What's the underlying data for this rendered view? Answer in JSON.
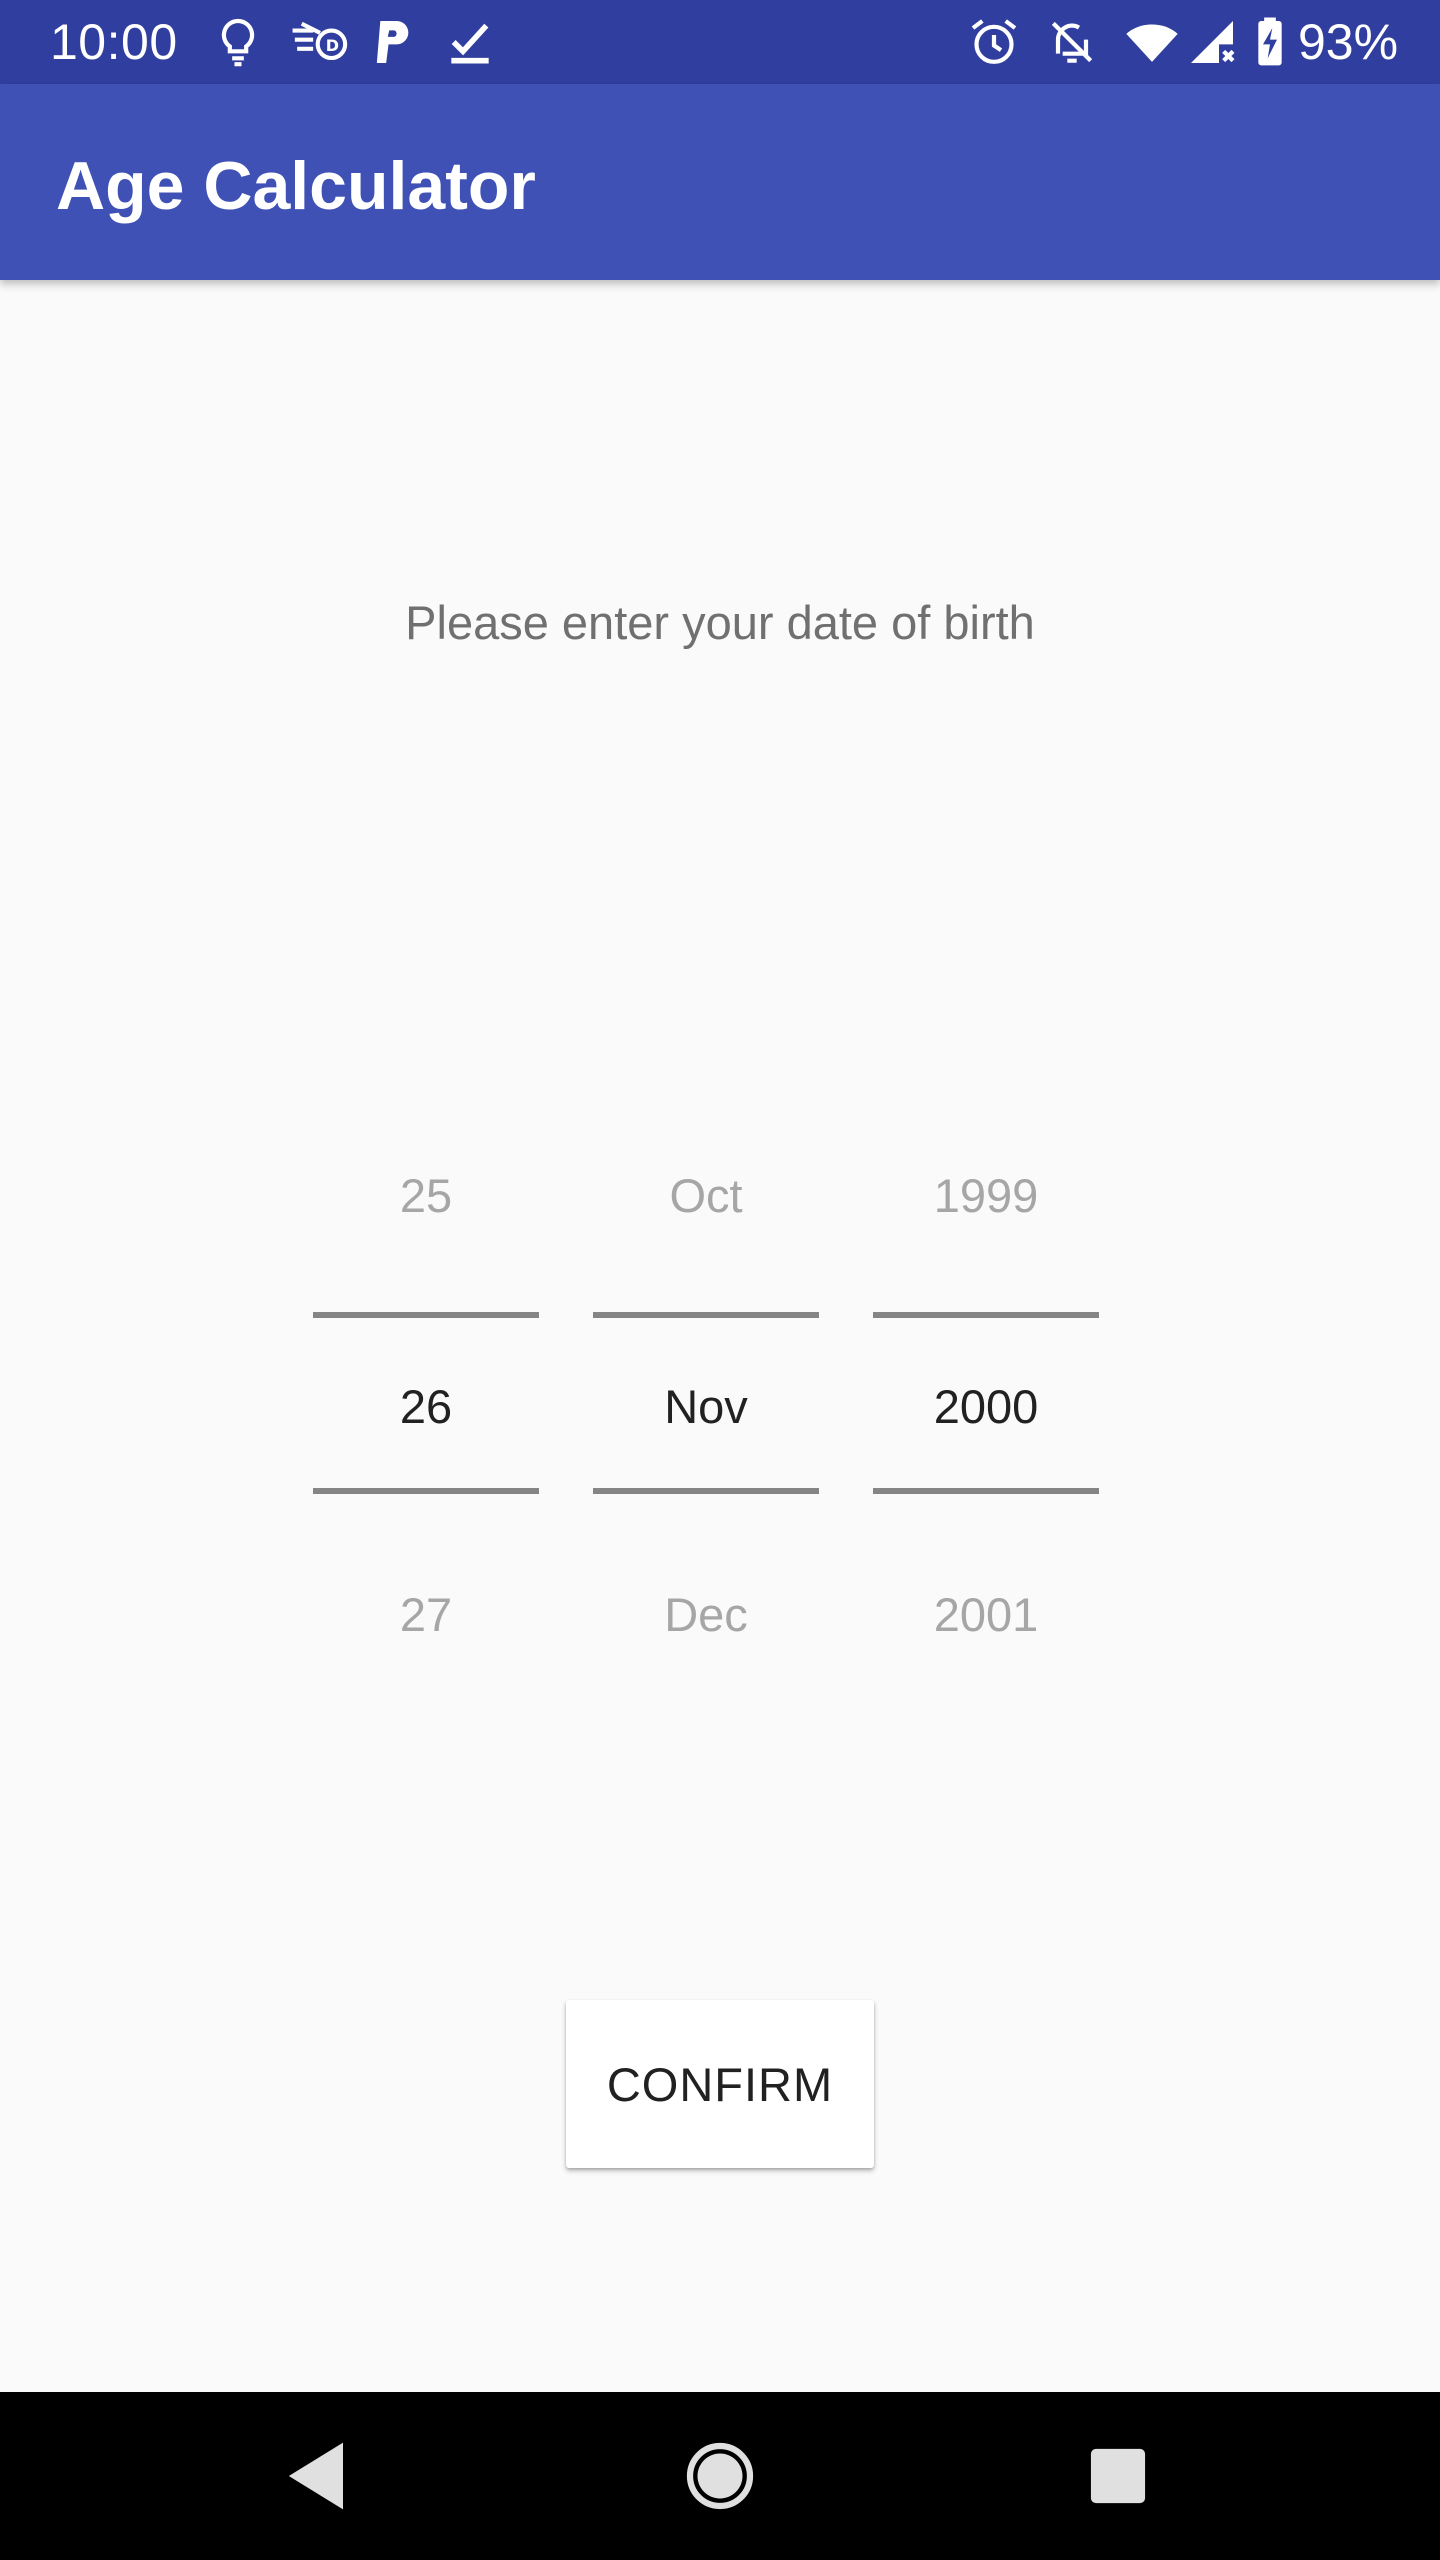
{
  "status_bar": {
    "time": "10:00",
    "battery": "93%",
    "background": "#303f9f",
    "icons": [
      "lightbulb-icon",
      "speed-data-icon",
      "paypal-icon",
      "check-icon",
      "alarm-icon",
      "bell-off-icon",
      "wifi-icon",
      "signal-icon",
      "battery-charging-icon"
    ]
  },
  "app_bar": {
    "title": "Age Calculator",
    "background": "#3f51b5"
  },
  "main": {
    "prompt": "Please enter your date of birth",
    "pickers": {
      "day": {
        "prev": "25",
        "current": "26",
        "next": "27"
      },
      "month": {
        "prev": "Oct",
        "current": "Nov",
        "next": "Dec"
      },
      "year": {
        "prev": "1999",
        "current": "2000",
        "next": "2001"
      }
    },
    "confirm_label": "CONFIRM"
  },
  "nav_bar": {
    "icons": [
      "back-icon",
      "home-icon",
      "recents-icon"
    ]
  }
}
